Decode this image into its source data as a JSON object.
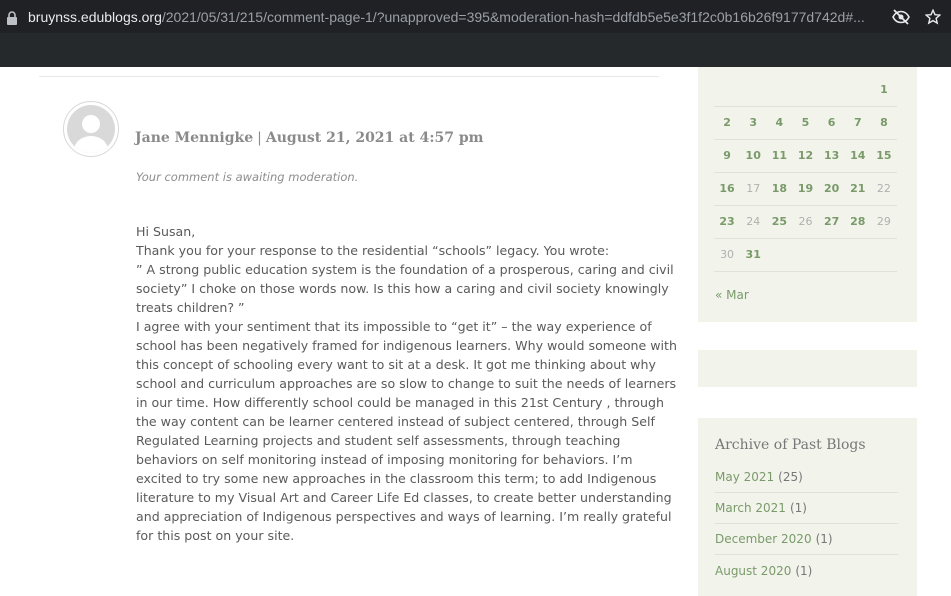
{
  "browser": {
    "url_host": "bruynss.edublogs.org",
    "url_path": "/2021/05/31/215/comment-page-1/?unapproved=395&moderation-hash=ddfdb5e5e3f1f2c0b16b26f9177d742d#..."
  },
  "comment": {
    "author": "Jane Mennigke",
    "separator": "|",
    "date": "August 21, 2021 at 4:57 pm",
    "moderation_notice": "Your comment is awaiting moderation.",
    "body_lines": [
      "Hi Susan,",
      "Thank you for your response to the residential “schools” legacy. You wrote:",
      "” A strong public education system is the foundation of a prosperous, caring and civil",
      "society” I choke on those words now. Is this how a caring and civil society knowingly",
      "treats children? ”",
      "I agree with your sentiment that its impossible to “get it” – the way experience of",
      "school has been negatively framed for indigenous learners. Why would someone with",
      "this concept of schooling every want to sit at a desk. It got me thinking about why",
      "school and curriculum approaches are so slow to change to suit the needs of learners",
      "in our time. How differently school could be managed in this 21st Century , through",
      "the way content can be learner centered instead of subject centered, through Self",
      "Regulated Learning projects and student self assessments, through teaching",
      "behaviors on self monitoring instead of imposing monitoring for behaviors. I’m",
      "excited to try some new approaches in the classroom this term; to add Indigenous",
      "literature to my Visual Art and Career Life Ed classes, to create better understanding",
      "and appreciation of Indigenous perspectives and ways of learning. I’m really grateful",
      "for this post on your site."
    ]
  },
  "calendar": {
    "rows": [
      [
        {
          "d": "",
          "t": "empty"
        },
        {
          "d": "",
          "t": "empty"
        },
        {
          "d": "",
          "t": "empty"
        },
        {
          "d": "",
          "t": "empty"
        },
        {
          "d": "",
          "t": "empty"
        },
        {
          "d": "",
          "t": "empty"
        },
        {
          "d": "1",
          "t": "link"
        }
      ],
      [
        {
          "d": "2",
          "t": "link"
        },
        {
          "d": "3",
          "t": "link"
        },
        {
          "d": "4",
          "t": "link"
        },
        {
          "d": "5",
          "t": "link"
        },
        {
          "d": "6",
          "t": "link"
        },
        {
          "d": "7",
          "t": "link"
        },
        {
          "d": "8",
          "t": "link"
        }
      ],
      [
        {
          "d": "9",
          "t": "link"
        },
        {
          "d": "10",
          "t": "link"
        },
        {
          "d": "11",
          "t": "link"
        },
        {
          "d": "12",
          "t": "link"
        },
        {
          "d": "13",
          "t": "link"
        },
        {
          "d": "14",
          "t": "link"
        },
        {
          "d": "15",
          "t": "link"
        }
      ],
      [
        {
          "d": "16",
          "t": "link"
        },
        {
          "d": "17",
          "t": "muted"
        },
        {
          "d": "18",
          "t": "link"
        },
        {
          "d": "19",
          "t": "link"
        },
        {
          "d": "20",
          "t": "link"
        },
        {
          "d": "21",
          "t": "link"
        },
        {
          "d": "22",
          "t": "muted"
        }
      ],
      [
        {
          "d": "23",
          "t": "link"
        },
        {
          "d": "24",
          "t": "muted"
        },
        {
          "d": "25",
          "t": "link"
        },
        {
          "d": "26",
          "t": "muted"
        },
        {
          "d": "27",
          "t": "link"
        },
        {
          "d": "28",
          "t": "link"
        },
        {
          "d": "29",
          "t": "muted"
        }
      ],
      [
        {
          "d": "30",
          "t": "muted"
        },
        {
          "d": "31",
          "t": "link"
        },
        {
          "d": "",
          "t": "empty"
        },
        {
          "d": "",
          "t": "empty"
        },
        {
          "d": "",
          "t": "empty"
        },
        {
          "d": "",
          "t": "empty"
        },
        {
          "d": "",
          "t": "empty"
        }
      ]
    ],
    "prev_link": "« Mar"
  },
  "archive": {
    "title": "Archive of Past Blogs",
    "items": [
      {
        "label": "May 2021",
        "count": "(25)"
      },
      {
        "label": "March 2021",
        "count": "(1)"
      },
      {
        "label": "December 2020",
        "count": "(1)"
      },
      {
        "label": "August 2020",
        "count": "(1)"
      }
    ]
  },
  "colors": {
    "accent_green": "#7a9a6a",
    "widget_bg": "#f2f4ec",
    "chrome_bg": "#202124"
  }
}
